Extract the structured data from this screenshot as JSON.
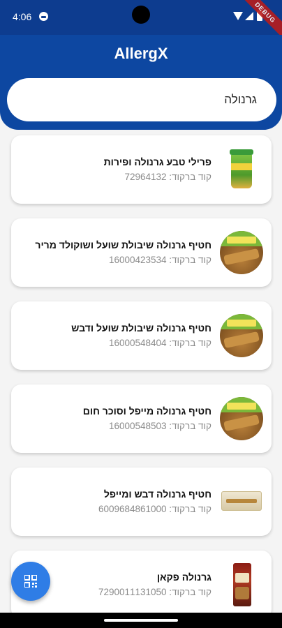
{
  "status_bar": {
    "time": "4:06",
    "debug_label": "DEBUG"
  },
  "header": {
    "title": "AllergX",
    "search_value": "גרנולה",
    "background_color": "#0d47a1"
  },
  "products": [
    {
      "name": "פרילי טבע גרנולה ופירות",
      "barcode": "קוד ברקוד: 72964132",
      "image_icon": "yogurt-cup-icon"
    },
    {
      "name": "חטיף גרנולה שיבולת שועל ושוקולד מריר",
      "barcode": "קוד ברקוד: 16000423534",
      "image_icon": "granola-bar-icon"
    },
    {
      "name": "חטיף גרנולה שיבולת שועל ודבש",
      "barcode": "קוד ברקוד: 16000548404",
      "image_icon": "granola-bar-icon"
    },
    {
      "name": "חטיף גרנולה מייפל וסוכר חום",
      "barcode": "קוד ברקוד: 16000548503",
      "image_icon": "granola-bar-icon"
    },
    {
      "name": "חטיף גרנולה דבש ומייפל",
      "barcode": "קוד ברקוד: 6009684861000",
      "image_icon": "snack-box-icon"
    },
    {
      "name": "גרנולה פקאן",
      "barcode": "קוד ברקוד: 7290011131050",
      "image_icon": "granola-bag-icon"
    }
  ],
  "fab": {
    "icon": "qr-scan-icon",
    "color": "#2f7de6"
  }
}
